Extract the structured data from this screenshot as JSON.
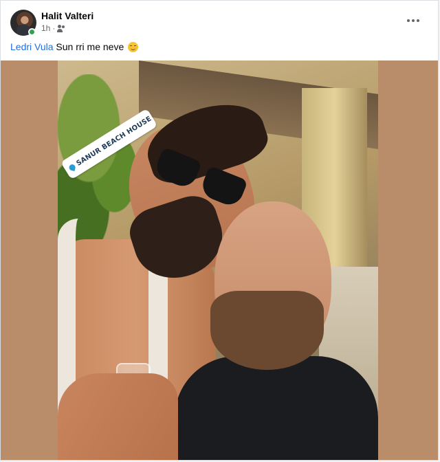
{
  "post": {
    "author": "Halit Valteri",
    "timestamp": "1h",
    "separator": "·",
    "audience_icon": "friends-icon",
    "more_icon": "more-options-icon",
    "tagged_user": "Ledri Vula",
    "text": "Sun rri me neve",
    "emoji": "smiling-face-emoji"
  },
  "photo": {
    "location_sticker": "SANUR BEACH HOUSE",
    "location_icon": "map-pin-icon",
    "colors": {
      "backdrop": "#b98c6a",
      "link": "#216fdb",
      "online": "#31a24c"
    }
  }
}
